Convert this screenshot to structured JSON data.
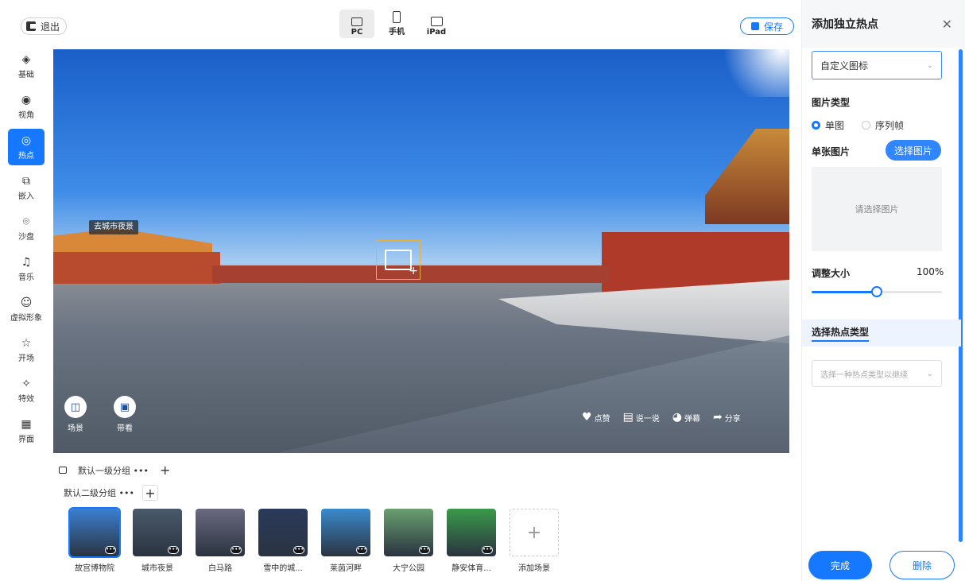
{
  "topbar": {
    "exit_label": "退出",
    "devices": [
      {
        "label": "PC"
      },
      {
        "label": "手机"
      },
      {
        "label": "iPad"
      }
    ],
    "save_label": "保存"
  },
  "leftnav": {
    "items": [
      {
        "label": "基础",
        "icon": "layers-icon"
      },
      {
        "label": "视角",
        "icon": "eye-icon"
      },
      {
        "label": "热点",
        "icon": "target-icon"
      },
      {
        "label": "嵌入",
        "icon": "embed-icon"
      },
      {
        "label": "沙盘",
        "icon": "pin-icon"
      },
      {
        "label": "音乐",
        "icon": "music-icon"
      },
      {
        "label": "虚拟形象",
        "icon": "smile-icon"
      },
      {
        "label": "开场",
        "icon": "star-icon"
      },
      {
        "label": "特效",
        "icon": "wand-icon"
      },
      {
        "label": "界面",
        "icon": "grid-icon"
      }
    ],
    "active_index": 2
  },
  "viewport": {
    "scene_tag": "去城市夜景",
    "left_buttons": [
      {
        "label": "场景"
      },
      {
        "label": "带看"
      }
    ],
    "social": [
      {
        "label": "点赞"
      },
      {
        "label": "说一说"
      },
      {
        "label": "弹幕"
      },
      {
        "label": "分享"
      }
    ]
  },
  "strip": {
    "group1": "默认一级分组 •••",
    "group2": "默认二级分组 •••",
    "scenes": [
      {
        "label": "故宫博物院",
        "color": "#3a7fd0"
      },
      {
        "label": "城市夜景",
        "color": "#4a5a6a"
      },
      {
        "label": "白马路",
        "color": "#6a6a80"
      },
      {
        "label": "雪中的城...",
        "color": "#2a3a5a"
      },
      {
        "label": "莱茵河畔",
        "color": "#3a8acc"
      },
      {
        "label": "大宁公园",
        "color": "#6aa070"
      },
      {
        "label": "静安体育...",
        "color": "#3a9a4a"
      }
    ],
    "add_label": "添加场景"
  },
  "panel": {
    "title": "添加独立热点",
    "icon_select": "自定义图标",
    "image_type_label": "图片类型",
    "radio_single": "单图",
    "radio_sequence": "序列帧",
    "single_image_label": "单张图片",
    "pick_image": "选择图片",
    "placeholder": "请选择图片",
    "size_label": "调整大小",
    "size_value": "100%",
    "hotspot_type_label": "选择热点类型",
    "hotspot_type_placeholder": "选择一种热点类型以继续",
    "done": "完成",
    "delete": "删除"
  },
  "colors": {
    "accent": "#1677ff"
  }
}
